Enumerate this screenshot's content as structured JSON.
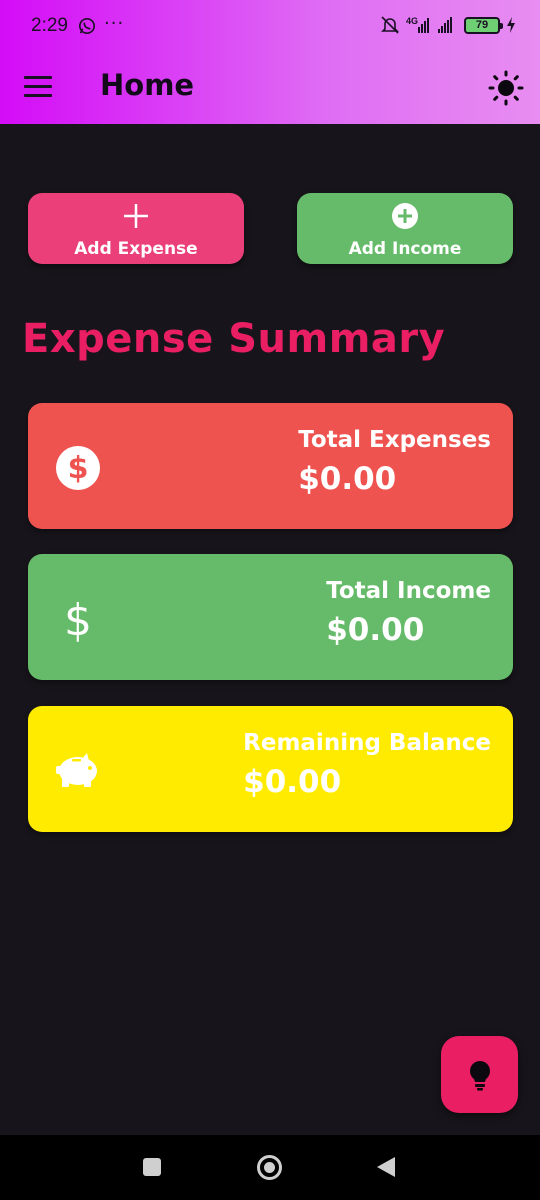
{
  "status_bar": {
    "time": "2:29",
    "more": "···",
    "network": "4G",
    "battery": "79"
  },
  "app_bar": {
    "title": "Home"
  },
  "actions": {
    "add_expense": "Add Expense",
    "add_income": "Add Income"
  },
  "summary": {
    "title": "Expense Summary",
    "cards": [
      {
        "label": "Total Expenses",
        "value": "$0.00",
        "icon": "dollar-circle-icon",
        "color": "#ef5350"
      },
      {
        "label": "Total Income",
        "value": "$0.00",
        "icon": "dollar-icon",
        "color": "#66bb6a"
      },
      {
        "label": "Remaining Balance",
        "value": "$0.00",
        "icon": "piggy-bank-icon",
        "color": "#ffeb00"
      }
    ]
  },
  "colors": {
    "accent": "#e91e63",
    "header_gradient_start": "#d40cf7",
    "header_gradient_end": "#e88df1",
    "background": "#17151b"
  }
}
